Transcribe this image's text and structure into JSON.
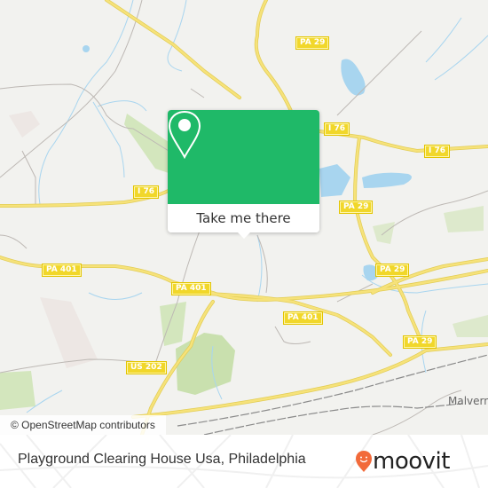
{
  "map": {
    "road_labels": [
      {
        "id": "pa29-north",
        "text": "PA 29"
      },
      {
        "id": "i76-center",
        "text": "I 76"
      },
      {
        "id": "i76-east",
        "text": "I 76"
      },
      {
        "id": "i76-west",
        "text": "I 76"
      },
      {
        "id": "pa29-mid",
        "text": "PA 29"
      },
      {
        "id": "pa29-east",
        "text": "PA 29"
      },
      {
        "id": "pa29-south",
        "text": "PA 29"
      },
      {
        "id": "pa401-west",
        "text": "PA 401"
      },
      {
        "id": "pa401-mid",
        "text": "PA 401"
      },
      {
        "id": "pa401-east",
        "text": "PA 401"
      },
      {
        "id": "us202",
        "text": "US 202"
      }
    ],
    "place_labels": [
      {
        "id": "malvern",
        "text": "Malvern"
      }
    ],
    "attribution": "© OpenStreetMap contributors",
    "colors": {
      "background": "#f2f2ef",
      "road": "#f6e27a",
      "water": "#a8d5ef",
      "park": "#d3e6bd"
    }
  },
  "popup": {
    "icon": "map-pin-icon",
    "action_label": "Take me there",
    "accent_color": "#1fb968"
  },
  "footer": {
    "title": "Playground Clearing House Usa, Philadelphia",
    "logo_text": "moovit",
    "logo_icon": "moovit-smiley-pin-icon",
    "logo_color": "#f26a3a"
  }
}
